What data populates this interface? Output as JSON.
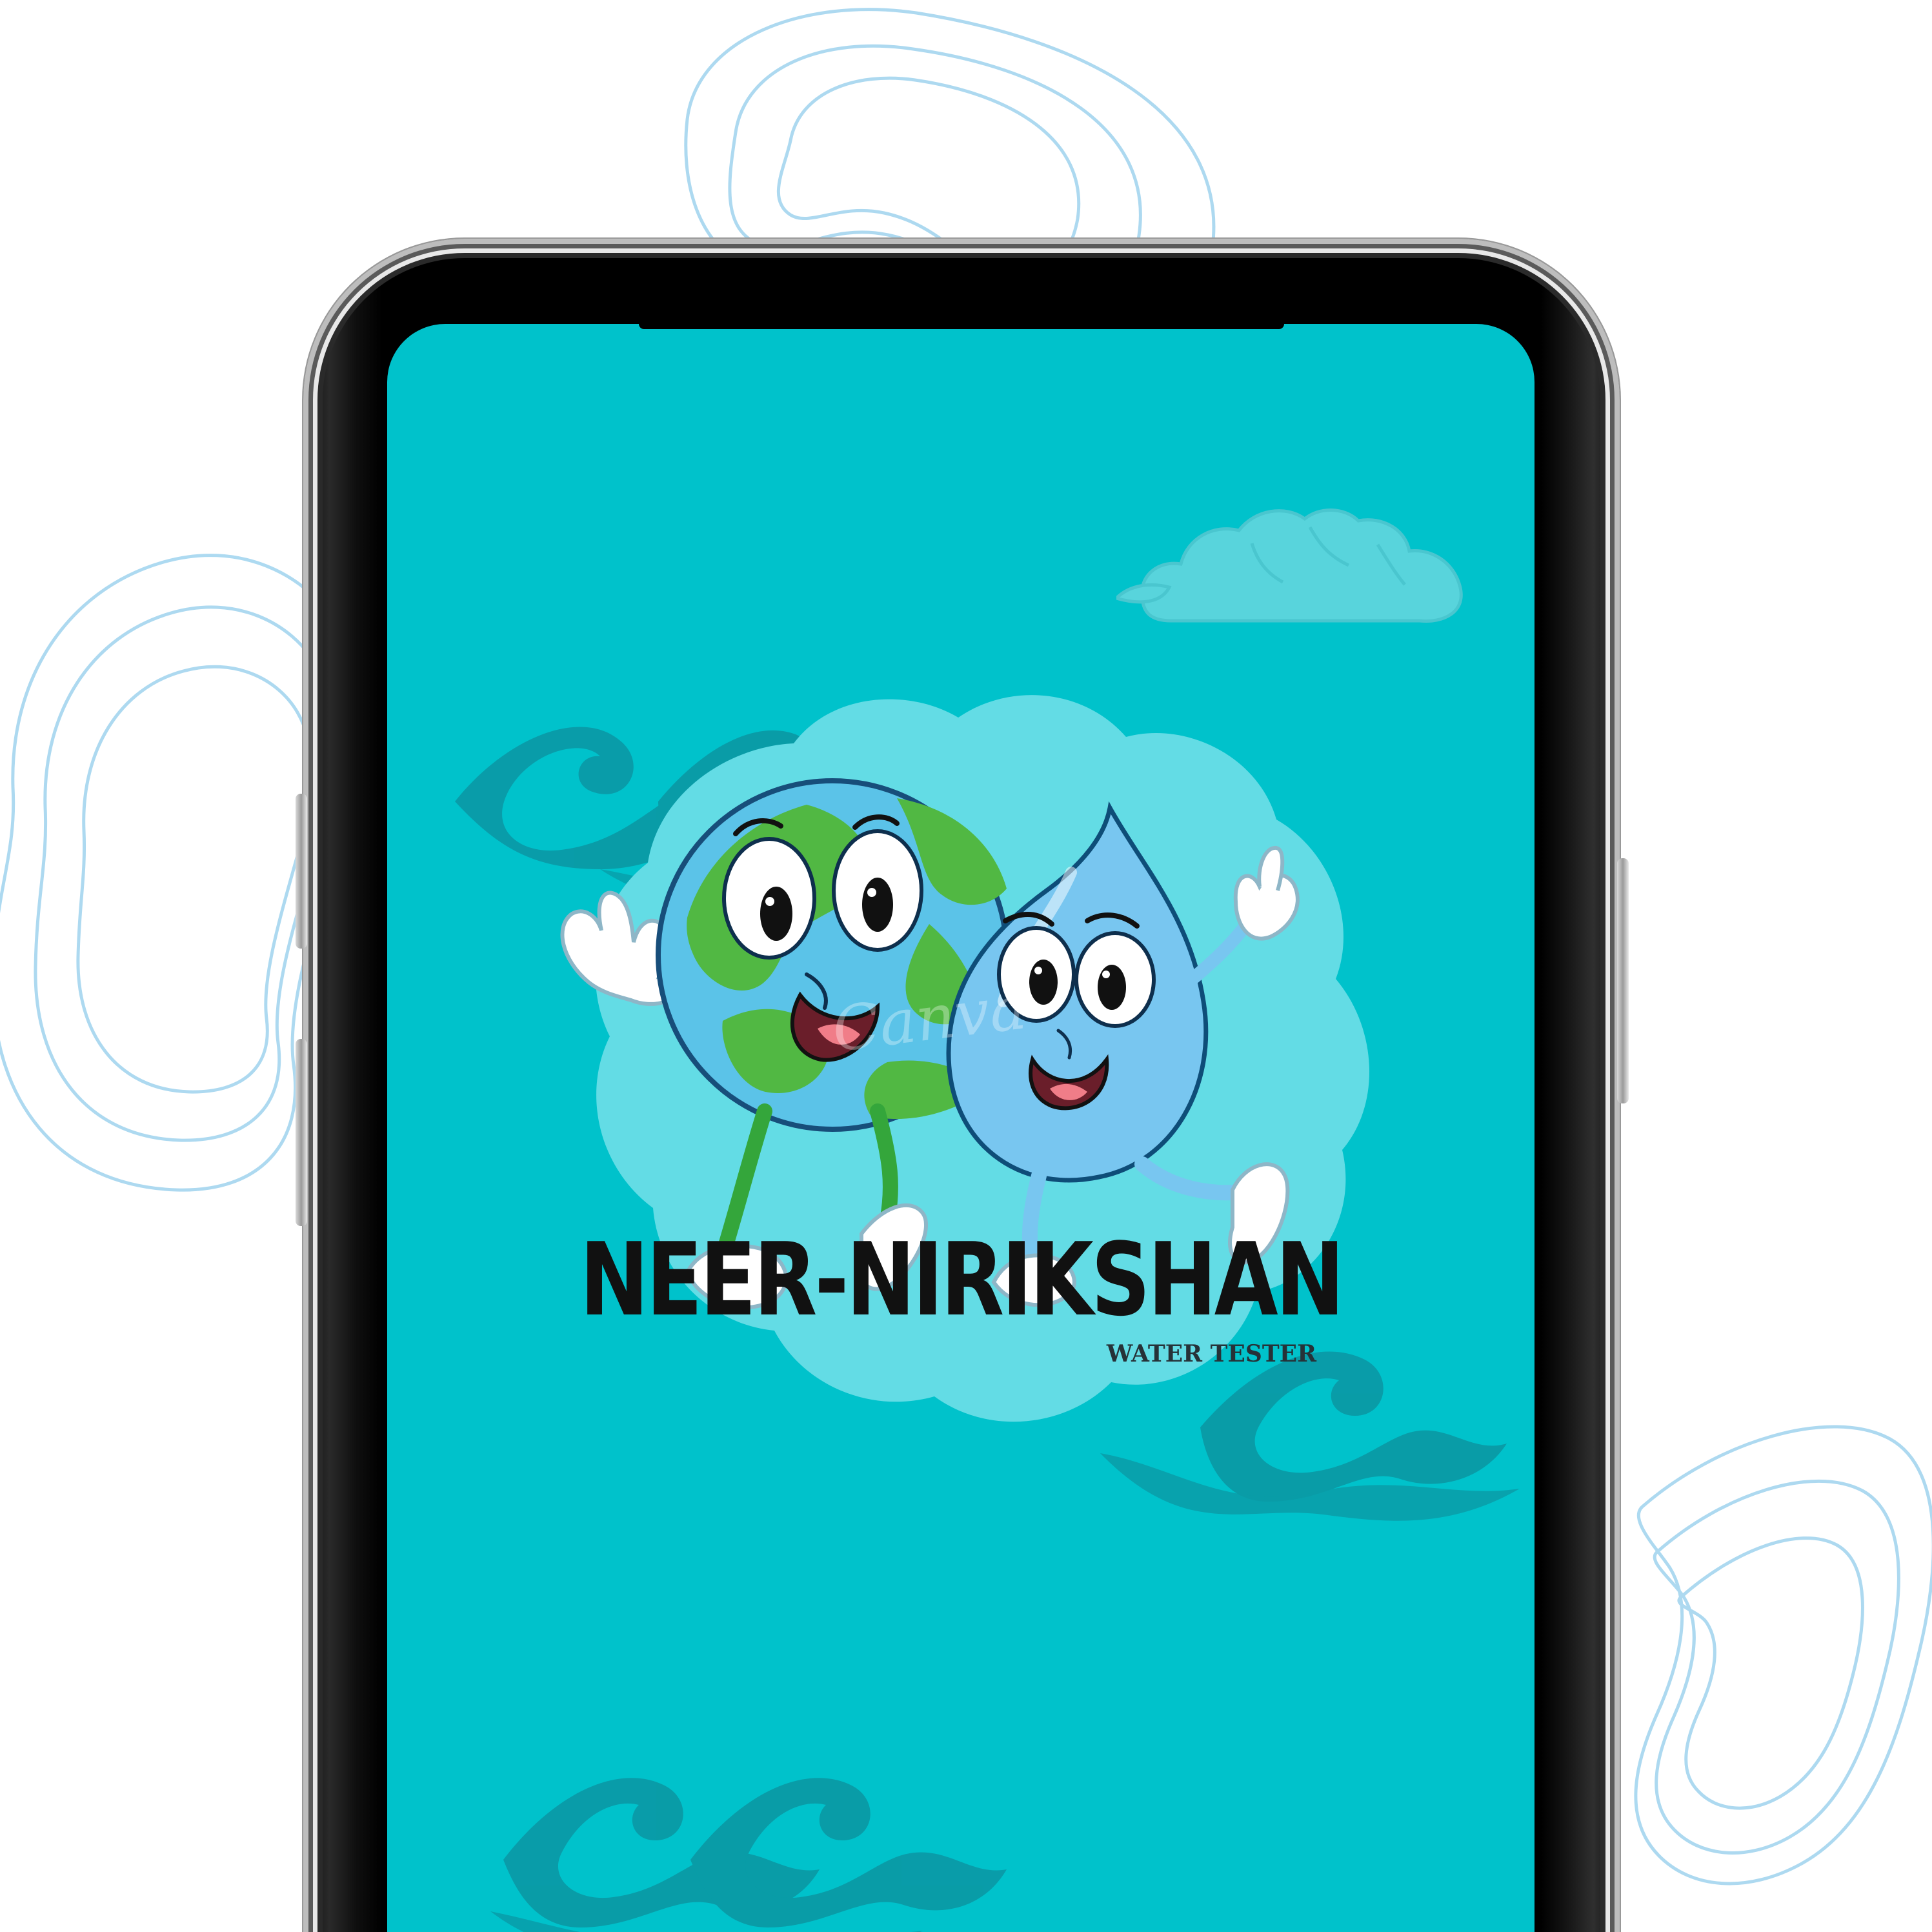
{
  "app": {
    "name": "NEER-NIRIKSHAN",
    "subtitle": "WATER TESTER"
  },
  "watermark": {
    "text": "Canva"
  },
  "colors": {
    "background": "#ffffff",
    "screen": "#00c2cb",
    "badge": "#63dce5",
    "wave": "#0a9aa6",
    "cloud": "#5dd6dd",
    "outline": "#a9d8f0",
    "text": "#111111"
  },
  "icons": {
    "earth": "earth-mascot-icon",
    "drop": "water-drop-mascot-icon",
    "cloud": "cloud-icon",
    "wave": "wave-icon"
  }
}
